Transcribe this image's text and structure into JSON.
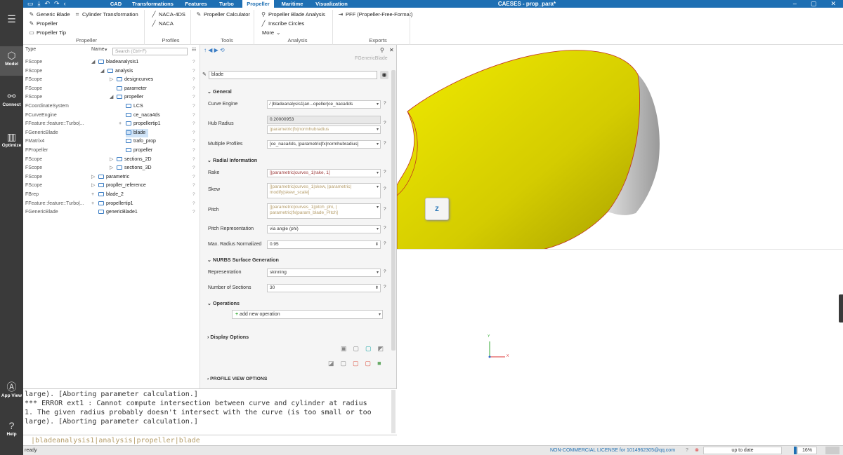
{
  "app": {
    "title": "CAESES - prop_para*"
  },
  "tabs": [
    {
      "label": "CAD",
      "active": false
    },
    {
      "label": "Transformations",
      "active": false
    },
    {
      "label": "Features",
      "active": false
    },
    {
      "label": "Turbo",
      "active": false
    },
    {
      "label": "Propeller",
      "active": true
    },
    {
      "label": "Maritime",
      "active": false
    },
    {
      "label": "Visualization",
      "active": false
    }
  ],
  "ribbon": {
    "propeller_group": {
      "label": "Propeller",
      "items": [
        "Generic Blade",
        "Propeller",
        "Propeller Tip",
        "Cylinder Transformation"
      ]
    },
    "profiles_group": {
      "label": "Profiles",
      "items": [
        "NACA-4DS",
        "NACA"
      ]
    },
    "tools_group": {
      "label": "Tools",
      "items": [
        "Propeller Calculator"
      ]
    },
    "analysis_group": {
      "label": "Analysis",
      "items": [
        "Propeller Blade Analysis",
        "Inscribe Circles",
        "More"
      ]
    },
    "exports_group": {
      "label": "Exports",
      "items": [
        "PFF (Propeller-Free-Format)"
      ]
    }
  },
  "sidebar": {
    "items": [
      "Model",
      "Connect",
      "Optimize",
      "App View",
      "Help"
    ]
  },
  "tree": {
    "col_type": "Type",
    "col_name": "Name",
    "search_placeholder": "Search (Ctrl+F)",
    "rows": [
      {
        "type": "FScope",
        "name": "bladeanalysis1",
        "indent": 0,
        "exp": "◢"
      },
      {
        "type": "FScope",
        "name": "analysis",
        "indent": 1,
        "exp": "◢"
      },
      {
        "type": "FScope",
        "name": "designcurves",
        "indent": 2,
        "exp": "▷"
      },
      {
        "type": "FScope",
        "name": "parameter",
        "indent": 2,
        "exp": ""
      },
      {
        "type": "FScope",
        "name": "propeller",
        "indent": 2,
        "exp": "◢"
      },
      {
        "type": "FCoordinateSystem",
        "name": "LCS",
        "indent": 3,
        "exp": ""
      },
      {
        "type": "FCurveEngine",
        "name": "ce_naca4ds",
        "indent": 3,
        "exp": ""
      },
      {
        "type": "FFeature::feature::Turbo|...",
        "name": "propellertip1",
        "indent": 3,
        "exp": "+"
      },
      {
        "type": "FGenericBlade",
        "name": "blade",
        "indent": 3,
        "exp": "",
        "sel": true
      },
      {
        "type": "FMatrix4",
        "name": "trafo_prop",
        "indent": 3,
        "exp": ""
      },
      {
        "type": "FPropeller",
        "name": "propeller",
        "indent": 3,
        "exp": ""
      },
      {
        "type": "FScope",
        "name": "sections_2D",
        "indent": 2,
        "exp": "▷"
      },
      {
        "type": "FScope",
        "name": "sections_3D",
        "indent": 2,
        "exp": "▷"
      },
      {
        "type": "FScope",
        "name": "parametric",
        "indent": 0,
        "exp": "▷"
      },
      {
        "type": "FScope",
        "name": "propller_reference",
        "indent": 0,
        "exp": "▷"
      },
      {
        "type": "FBrep",
        "name": "blade_2",
        "indent": 0,
        "exp": "+"
      },
      {
        "type": "FFeature::feature::Turbo|...",
        "name": "propellertip1",
        "indent": 0,
        "exp": "+"
      },
      {
        "type": "FGenericBlade",
        "name": "genericBlade1",
        "indent": 0,
        "exp": ""
      }
    ]
  },
  "props": {
    "header": "FGenericBlade",
    "name": "blade",
    "sections": {
      "general": "General",
      "radial": "Radial Information",
      "nurbs": "NURBS Surface Generation",
      "operations": "Operations",
      "display": "Display Options",
      "profile": "PROFILE VIEW OPTIONS"
    },
    "labels": {
      "curve_engine": "Curve Engine",
      "hub_radius": "Hub Radius",
      "multiple_profiles": "Multiple Profiles",
      "rake": "Rake",
      "skew": "Skew",
      "pitch": "Pitch",
      "pitch_rep": "Pitch Representation",
      "max_radius": "Max. Radius Normalized",
      "representation": "Representation",
      "num_sections": "Number of Sections",
      "add_op": "add new operation"
    },
    "values": {
      "curve_engine": "|bladeanalysis1|an...opeller|ce_naca4ds",
      "hub_radius_val": "0.20000953",
      "hub_radius_expr": "|parametric|fx|normhubradius",
      "multiple_profiles": "[ce_naca4ds, |parametric|fx|normhubradius]",
      "rake": "[|parametric|curves_1|rake, 1]",
      "skew_1": "[|parametric|curves_1|skew, |parametric|",
      "skew_2": "modify|skew_scale]",
      "pitch_1": "[|parametric|curves_1|pitch_phi, |",
      "pitch_2": "parametric|fx|param_blade_Pitch]",
      "pitch_rep": "via angle (phi)",
      "max_radius": "0.95",
      "representation": "skinning",
      "num_sections": "30"
    }
  },
  "console": {
    "lines": [
      "large). [Aborting parameter calculation.]",
      "*** ERROR ext1 : Cannot compute intersection between curve and cylinder at radius",
      "1. The given radius probably doesn't intersect with the curve (is too small or too",
      "large). [Aborting parameter calculation.]"
    ],
    "command": "|bladeanalysis1|analysis|propeller|blade"
  },
  "status": {
    "ready": "ready",
    "license": "NON-COMMERCIAL LICENSE for 1014962305@qq.com",
    "update": "up to date",
    "zoom": "16%"
  },
  "viewport": {
    "cube_label": "Z",
    "axis_y": "Y",
    "axis_x": "X"
  },
  "colors": {
    "brand": "#1e6fb3",
    "blade": "#e6e000"
  }
}
